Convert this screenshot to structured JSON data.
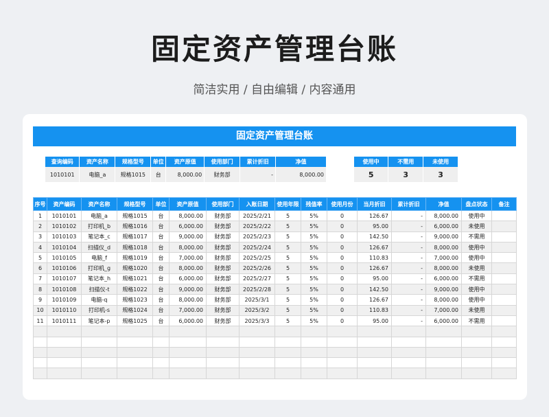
{
  "header": {
    "title": "固定资产管理台账",
    "subtitle": "简洁实用 / 自由编辑 / 内容通用"
  },
  "sheet": {
    "title": "固定资产管理台账"
  },
  "query": {
    "headers": [
      "查询编码",
      "资产名称",
      "规格型号",
      "单位",
      "资产原值",
      "使用部门",
      "累计折旧",
      "净值"
    ],
    "values": [
      "1010101",
      "电脑_a",
      "规格1015",
      "台",
      "8,000.00",
      "财务部",
      "-",
      "8,000.00"
    ]
  },
  "status_stats": {
    "headers": [
      "使用中",
      "不需用",
      "未使用"
    ],
    "values": [
      "5",
      "3",
      "3"
    ]
  },
  "table": {
    "headers": [
      "序号",
      "资产编码",
      "资产名称",
      "规格型号",
      "单位",
      "资产原值",
      "使用部门",
      "入账日期",
      "使用年限",
      "残值率",
      "使用月份",
      "当月折旧",
      "累计折旧",
      "净值",
      "盘点状态",
      "备注"
    ],
    "rows": [
      [
        "1",
        "1010101",
        "电脑_a",
        "规格1015",
        "台",
        "8,000.00",
        "财务部",
        "2025/2/21",
        "5",
        "5%",
        "0",
        "126.67",
        "-",
        "8,000.00",
        "使用中",
        ""
      ],
      [
        "2",
        "1010102",
        "打印机_b",
        "规格1016",
        "台",
        "6,000.00",
        "财务部",
        "2025/2/22",
        "5",
        "5%",
        "0",
        "95.00",
        "-",
        "6,000.00",
        "未使用",
        ""
      ],
      [
        "3",
        "1010103",
        "笔记本_c",
        "规格1017",
        "台",
        "9,000.00",
        "财务部",
        "2025/2/23",
        "5",
        "5%",
        "0",
        "142.50",
        "-",
        "9,000.00",
        "不需用",
        ""
      ],
      [
        "4",
        "1010104",
        "扫描仪_d",
        "规格1018",
        "台",
        "8,000.00",
        "财务部",
        "2025/2/24",
        "5",
        "5%",
        "0",
        "126.67",
        "-",
        "8,000.00",
        "使用中",
        ""
      ],
      [
        "5",
        "1010105",
        "电脑_f",
        "规格1019",
        "台",
        "7,000.00",
        "财务部",
        "2025/2/25",
        "5",
        "5%",
        "0",
        "110.83",
        "-",
        "7,000.00",
        "使用中",
        ""
      ],
      [
        "6",
        "1010106",
        "打印机_g",
        "规格1020",
        "台",
        "8,000.00",
        "财务部",
        "2025/2/26",
        "5",
        "5%",
        "0",
        "126.67",
        "-",
        "8,000.00",
        "未使用",
        ""
      ],
      [
        "7",
        "1010107",
        "笔记本_h",
        "规格1021",
        "台",
        "6,000.00",
        "财务部",
        "2025/2/27",
        "5",
        "5%",
        "0",
        "95.00",
        "-",
        "6,000.00",
        "不需用",
        ""
      ],
      [
        "8",
        "1010108",
        "扫描仪-t",
        "规格1022",
        "台",
        "9,000.00",
        "财务部",
        "2025/2/28",
        "5",
        "5%",
        "0",
        "142.50",
        "-",
        "9,000.00",
        "使用中",
        ""
      ],
      [
        "9",
        "1010109",
        "电脑-q",
        "规格1023",
        "台",
        "8,000.00",
        "财务部",
        "2025/3/1",
        "5",
        "5%",
        "0",
        "126.67",
        "-",
        "8,000.00",
        "使用中",
        ""
      ],
      [
        "10",
        "1010110",
        "打印机-s",
        "规格1024",
        "台",
        "7,000.00",
        "财务部",
        "2025/3/2",
        "5",
        "5%",
        "0",
        "110.83",
        "-",
        "7,000.00",
        "未使用",
        ""
      ],
      [
        "11",
        "1010111",
        "笔记本-p",
        "规格1025",
        "台",
        "6,000.00",
        "财务部",
        "2025/3/3",
        "5",
        "5%",
        "0",
        "95.00",
        "-",
        "6,000.00",
        "不需用",
        ""
      ]
    ],
    "empty_rows": 5
  }
}
